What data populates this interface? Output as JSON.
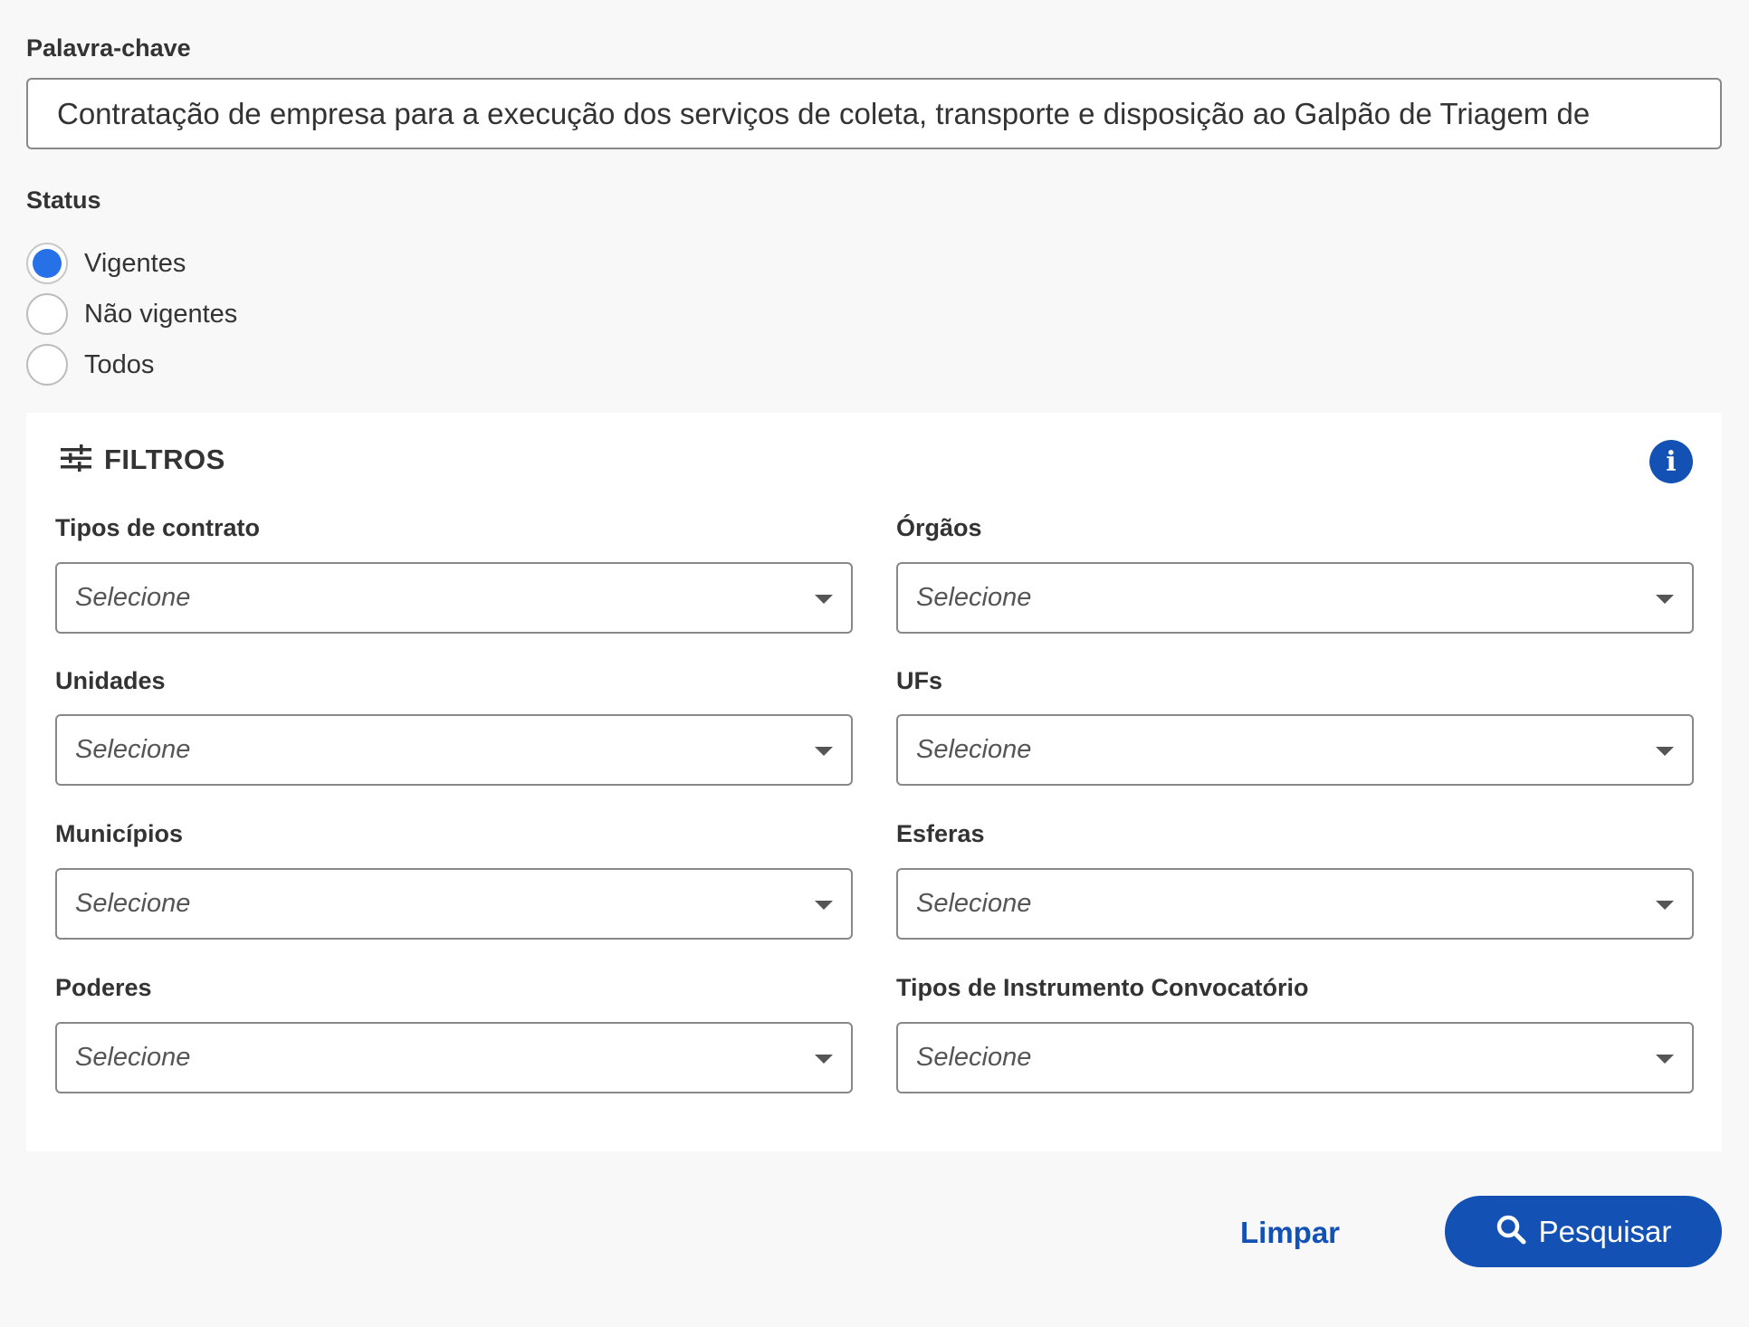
{
  "keyword": {
    "label": "Palavra-chave",
    "value": "Contratação de empresa para a execução dos serviços de coleta, transporte e disposição ao Galpão de Triagem de"
  },
  "status": {
    "label": "Status",
    "options": [
      {
        "label": "Vigentes",
        "checked": true
      },
      {
        "label": "Não vigentes",
        "checked": false
      },
      {
        "label": "Todos",
        "checked": false
      }
    ]
  },
  "filters": {
    "title": "FILTROS",
    "info_icon": "info-icon",
    "filter_icon": "sliders-icon",
    "fields": [
      {
        "label": "Tipos de contrato",
        "placeholder": "Selecione"
      },
      {
        "label": "Órgãos",
        "placeholder": "Selecione"
      },
      {
        "label": "Unidades",
        "placeholder": "Selecione"
      },
      {
        "label": "UFs",
        "placeholder": "Selecione"
      },
      {
        "label": "Municípios",
        "placeholder": "Selecione"
      },
      {
        "label": "Esferas",
        "placeholder": "Selecione"
      },
      {
        "label": "Poderes",
        "placeholder": "Selecione"
      },
      {
        "label": "Tipos de Instrumento Convocatório",
        "placeholder": "Selecione"
      }
    ]
  },
  "actions": {
    "clear_label": "Limpar",
    "search_label": "Pesquisar"
  },
  "colors": {
    "primary": "#1351b4",
    "radio_checked": "#2670e8",
    "background": "#f8f8f8"
  }
}
